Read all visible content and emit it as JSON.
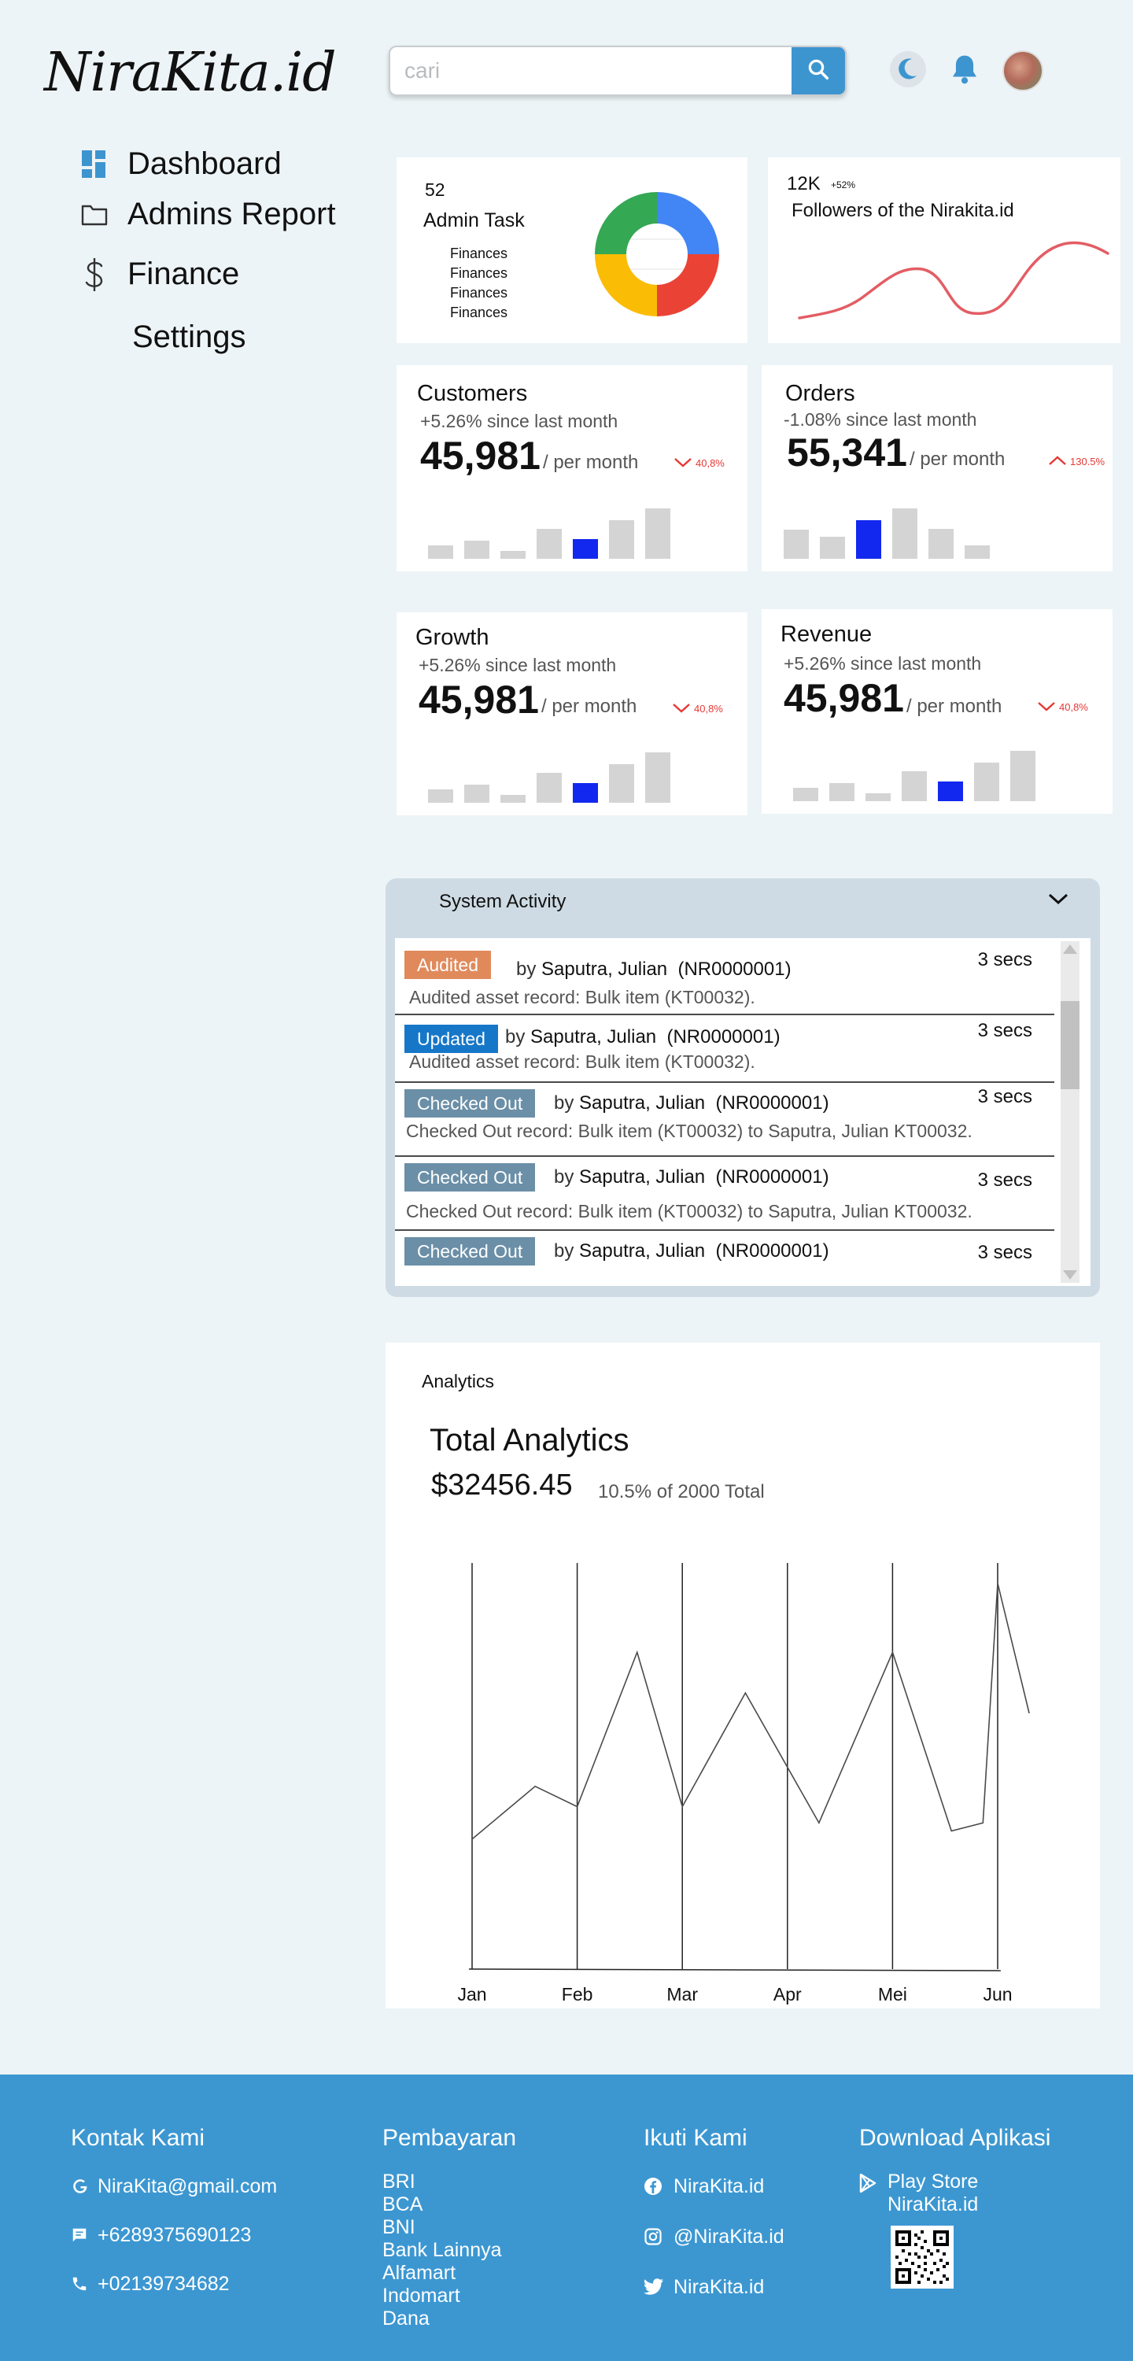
{
  "header": {
    "logo_text": "NiraKita.id",
    "search_placeholder": "cari",
    "icons": [
      "moon-icon",
      "bell-icon",
      "search-icon"
    ]
  },
  "sidebar": {
    "items": [
      {
        "label": "Dashboard",
        "icon": "dashboard-icon"
      },
      {
        "label": "Admins Report",
        "icon": "folder-icon"
      },
      {
        "label": "Finance",
        "icon": "dollar-icon"
      },
      {
        "label": "Settings",
        "icon": ""
      }
    ]
  },
  "admin_card": {
    "count": "52",
    "title": "Admin Task",
    "items": [
      "Finances",
      "Finances",
      "Finances",
      "Finances"
    ],
    "donut_colors": [
      "#4285f4",
      "#ea4335",
      "#fbbc05",
      "#34a853"
    ]
  },
  "followers_card": {
    "count": "12K",
    "change": "+52%",
    "title": "Followers of the Nirakita.id",
    "line_color": "#e35d64"
  },
  "stat_cards": [
    {
      "title": "Customers",
      "since": "+5.26% since last month",
      "value": "45,981",
      "per": "/ per month",
      "trend": "40,8%",
      "trend_dir": "down",
      "bars": [
        12,
        16,
        7,
        26,
        17,
        34,
        44
      ],
      "highlight": 4
    },
    {
      "title": "Orders",
      "since": "-1.08% since last month",
      "value": "55,341",
      "per": "/ per month",
      "trend": "130.5%",
      "trend_dir": "up",
      "bars": [
        31,
        24,
        41,
        54,
        32,
        14
      ],
      "highlight": 2
    },
    {
      "title": "Growth",
      "since": "+5.26% since last month",
      "value": "45,981",
      "per": "/ per month",
      "trend": "40,8%",
      "trend_dir": "down",
      "bars": [
        12,
        16,
        7,
        26,
        17,
        34,
        44
      ],
      "highlight": 4
    },
    {
      "title": "Revenue",
      "since": "+5.26% since last month",
      "value": "45,981",
      "per": "/ per month",
      "trend": "40,8%",
      "trend_dir": "down",
      "bars": [
        12,
        16,
        7,
        26,
        17,
        34,
        44
      ],
      "highlight": 4
    }
  ],
  "activity": {
    "title": "System Activity",
    "rows": [
      {
        "badge": "Audited",
        "badge_color": "#e08a5c",
        "by_prefix": "by",
        "by": "Saputra, Julian",
        "id": "(NR0000001)",
        "time": "3 secs",
        "desc": "Audited asset record: Bulk item (KT00032)."
      },
      {
        "badge": "Updated",
        "badge_color": "#1677c8",
        "by_prefix": "by",
        "by": "Saputra, Julian",
        "id": "(NR0000001)",
        "time": "3 secs",
        "desc": "Audited asset record: Bulk item (KT00032)."
      },
      {
        "badge": "Checked Out",
        "badge_color": "#6b8fa7",
        "by_prefix": "by",
        "by": "Saputra, Julian",
        "id": "(NR0000001)",
        "time": "3 secs",
        "desc": "Checked Out record: Bulk item (KT00032) to Saputra, Julian KT00032."
      },
      {
        "badge": "Checked Out",
        "badge_color": "#6b8fa7",
        "by_prefix": "by",
        "by": "Saputra, Julian",
        "id": "(NR0000001)",
        "time": "3 secs",
        "desc": "Checked Out record: Bulk item (KT00032) to Saputra, Julian KT00032."
      },
      {
        "badge": "Checked Out",
        "badge_color": "#6b8fa7",
        "by_prefix": "by",
        "by": "Saputra, Julian",
        "id": "(NR0000001)",
        "time": "3 secs",
        "desc": ""
      }
    ]
  },
  "analytics": {
    "label": "Analytics",
    "title": "Total Analytics",
    "amount": "$32456.45",
    "pct": "10.5% of 2000 Total"
  },
  "chart_data": {
    "type": "line",
    "categories": [
      "Jan",
      "Feb",
      "Mar",
      "Apr",
      "Mei",
      "Jun"
    ],
    "x": [
      0,
      0.6,
      1.0,
      1.57,
      2.0,
      2.6,
      3.3,
      4.0,
      4.56,
      4.86,
      5.0,
      5.3
    ],
    "y": [
      32,
      45,
      40,
      78,
      40,
      68,
      36,
      78,
      34,
      36,
      95,
      63
    ],
    "xlabel": "",
    "ylabel": "",
    "grid": true,
    "line_color": "#4a4a4a"
  },
  "footer": {
    "contact": {
      "title": "Kontak Kami",
      "items": [
        {
          "icon": "google-icon",
          "text": "NiraKita@gmail.com"
        },
        {
          "icon": "message-icon",
          "text": "+6289375690123"
        },
        {
          "icon": "phone-icon",
          "text": "+02139734682"
        }
      ]
    },
    "payment": {
      "title": "Pembayaran",
      "items": [
        "BRI",
        "BCA",
        "BNI",
        "Bank Lainnya",
        "Alfamart",
        "Indomart",
        "Dana"
      ]
    },
    "social": {
      "title": "Ikuti Kami",
      "items": [
        {
          "icon": "facebook-icon",
          "text": "NiraKita.id"
        },
        {
          "icon": "instagram-icon",
          "text": "@NiraKita.id"
        },
        {
          "icon": "twitter-icon",
          "text": "NiraKita.id"
        }
      ]
    },
    "download": {
      "title": "Download Aplikasi",
      "store": "Play Store",
      "store_name": "NiraKita.id"
    },
    "bg_color": "#3c97d1"
  }
}
